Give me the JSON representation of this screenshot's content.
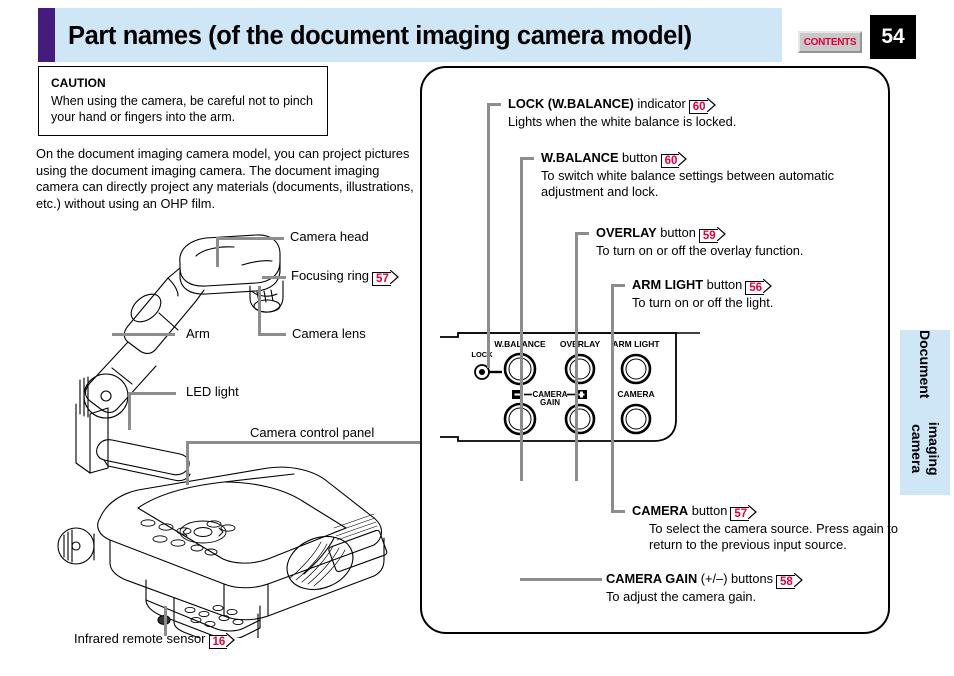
{
  "header": {
    "title": "Part names (of the document imaging camera model)",
    "contents_label": "CONTENTS",
    "page_number": "54",
    "accent_color": "#451b7d",
    "band_color": "#cfe6f7"
  },
  "side_tab": {
    "label": "Document\nimaging camera",
    "line1": "Document",
    "line2": "imaging camera",
    "color": "#cfe6f7"
  },
  "caution": {
    "title": "CAUTION",
    "text": "When using the camera, be careful not to pinch your hand or fingers into the arm."
  },
  "intro": {
    "text": "On the document imaging camera model, you can project pictures using the document imaging camera. The document imaging camera can directly project any materials (documents, illustrations, etc.) without using an OHP film."
  },
  "illustration_labels": [
    {
      "name": "camera-head",
      "text": "Camera head",
      "ref": null
    },
    {
      "name": "focusing-ring",
      "text": "Focusing ring",
      "ref": "57"
    },
    {
      "name": "camera-lens",
      "text": "Camera lens",
      "ref": null
    },
    {
      "name": "arm",
      "text": "Arm",
      "ref": null
    },
    {
      "name": "led-light",
      "text": "LED light",
      "ref": null
    },
    {
      "name": "camera-control-panel",
      "text": "Camera control panel",
      "ref": null
    },
    {
      "name": "infrared-remote-sensor",
      "text": "Infrared remote sensor",
      "ref": "16"
    }
  ],
  "callouts": [
    {
      "name": "lock-wbalance-indicator",
      "bold": "LOCK (W.BALANCE)",
      "rest": " indicator",
      "ref": "60",
      "desc": "Lights when the white balance is locked."
    },
    {
      "name": "wbalance-button",
      "bold": "W.BALANCE",
      "rest": " button",
      "ref": "60",
      "desc": "To switch white balance settings between automatic adjustment and lock."
    },
    {
      "name": "overlay-button",
      "bold": "OVERLAY",
      "rest": " button",
      "ref": "59",
      "desc": "To turn on or off the overlay function."
    },
    {
      "name": "arm-light-button",
      "bold": "ARM LIGHT",
      "rest": " button",
      "ref": "56",
      "desc": "To turn on or off the light."
    },
    {
      "name": "camera-button",
      "bold": "CAMERA",
      "rest": " button",
      "ref": "57",
      "desc": "To select the camera source. Press again to return to the previous input source."
    },
    {
      "name": "camera-gain-buttons",
      "bold": "CAMERA GAIN",
      "rest": " (+/–) buttons",
      "ref": "58",
      "desc": "To adjust the camera gain."
    }
  ],
  "control_panel": {
    "labels": {
      "lock": "LOCK",
      "wbalance": "W.BALANCE",
      "overlay": "OVERLAY",
      "arm_light": "ARM LIGHT",
      "camera_gain": "CAMERA",
      "camera_gain2": "GAIN",
      "camera": "CAMERA",
      "minus": "–",
      "plus": "+"
    }
  },
  "colors": {
    "ref_red": "#e3003c",
    "leader_gray": "#8d8d8d",
    "line_black": "#000000"
  }
}
